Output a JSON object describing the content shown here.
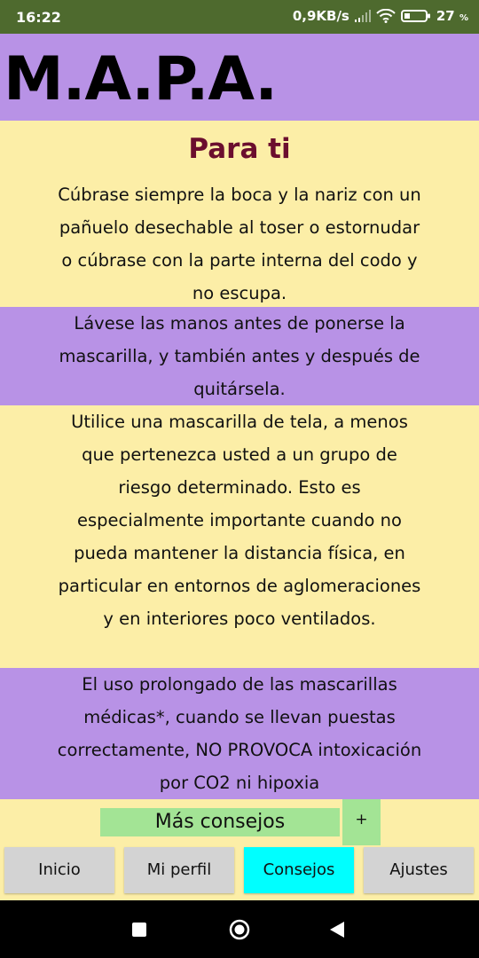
{
  "status_bar": {
    "time": "16:22",
    "net_speed": "0,9KB/s",
    "battery_value": "27",
    "battery_unit": "%",
    "icons": [
      "signal-icon",
      "wifi-icon",
      "battery-icon"
    ]
  },
  "header": {
    "title": "M.A.P.A."
  },
  "content": {
    "section_title": "Para ti",
    "tips": [
      "Cúbrase siempre la boca y la nariz con un pañuelo desechable al toser o estornudar o cúbrase con la parte interna del codo y no escupa.",
      "Lávese las manos antes de ponerse la mascarilla, y también antes y después de quitársela.",
      "Utilice una mascarilla de tela, a menos que pertenezca usted a un grupo de riesgo determinado. Esto es especialmente importante cuando no pueda mantener la distancia física, en particular en entornos de aglomeraciones y en interiores poco ventilados.",
      "El uso prolongado de las mascarillas médicas*, cuando se llevan puestas correctamente, NO PROVOCA intoxicación por CO2 ni hipoxia"
    ],
    "more_button": "Más consejos",
    "plus_button": "+"
  },
  "bottom_nav": {
    "items": [
      {
        "label": "Inicio",
        "active": false
      },
      {
        "label": "Mi perfil",
        "active": false
      },
      {
        "label": "Consejos",
        "active": true
      },
      {
        "label": "Ajustes",
        "active": false
      }
    ]
  },
  "system_nav": {
    "icons": [
      "recents-icon",
      "home-icon",
      "back-icon"
    ]
  },
  "colors": {
    "status_bar": "#4E6A2E",
    "purple": "#B892E6",
    "yellow": "#FCEEA7",
    "title": "#6B0E2E",
    "green_button": "#A3E495",
    "active_tab": "#00FFFF",
    "inactive_tab": "#D3D3D3"
  }
}
